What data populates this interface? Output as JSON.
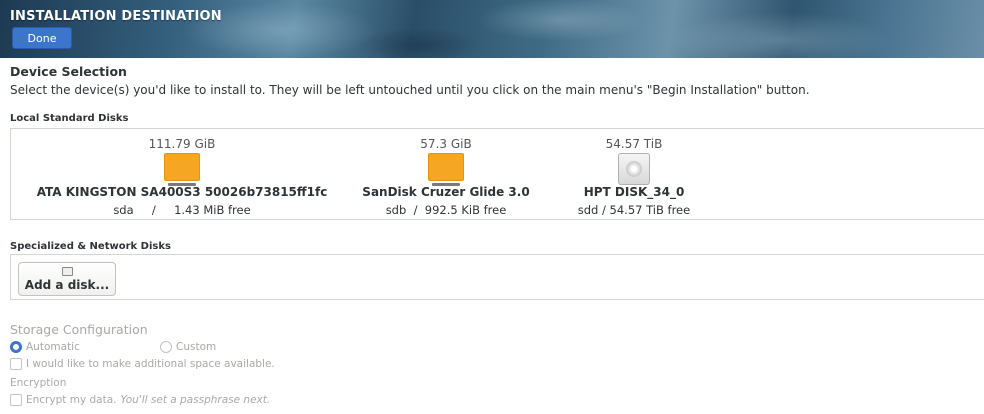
{
  "header": {
    "title": "INSTALLATION DESTINATION",
    "done_label": "Done"
  },
  "device_selection": {
    "title": "Device Selection",
    "instruction": "Select the device(s) you'd like to install to.  They will be left untouched until you click on the main menu's \"Begin Installation\" button."
  },
  "local_disks": {
    "heading": "Local Standard Disks",
    "disks": [
      {
        "size": "111.79 GiB",
        "icon": "usb-drive-icon",
        "name": "ATA KINGSTON SA400S3 50026b73815ff1fc",
        "info": "sda     /     1.43 MiB free"
      },
      {
        "size": "57.3 GiB",
        "icon": "usb-drive-icon",
        "name": "SanDisk Cruzer Glide 3.0",
        "info": "sdb  /  992.5 KiB free"
      },
      {
        "size": "54.57 TiB",
        "icon": "hard-disk-icon",
        "name": "HPT DISK_34_0",
        "info": "sdd / 54.57 TiB free"
      }
    ]
  },
  "network_disks": {
    "heading": "Specialized & Network Disks",
    "add_label": "Add a disk..."
  },
  "storage_config": {
    "title": "Storage Configuration",
    "automatic_label": "Automatic",
    "custom_label": "Custom",
    "selected": "Automatic",
    "additional_space_label": "I would like to make additional space available."
  },
  "encryption": {
    "heading": "Encryption",
    "encrypt_label": "Encrypt my data.",
    "encrypt_hint": "You'll set a passphrase next."
  },
  "colors": {
    "accent": "#3b75cc",
    "usb_drive": "#f5a623",
    "disabled_text": "#a8aaa6"
  }
}
